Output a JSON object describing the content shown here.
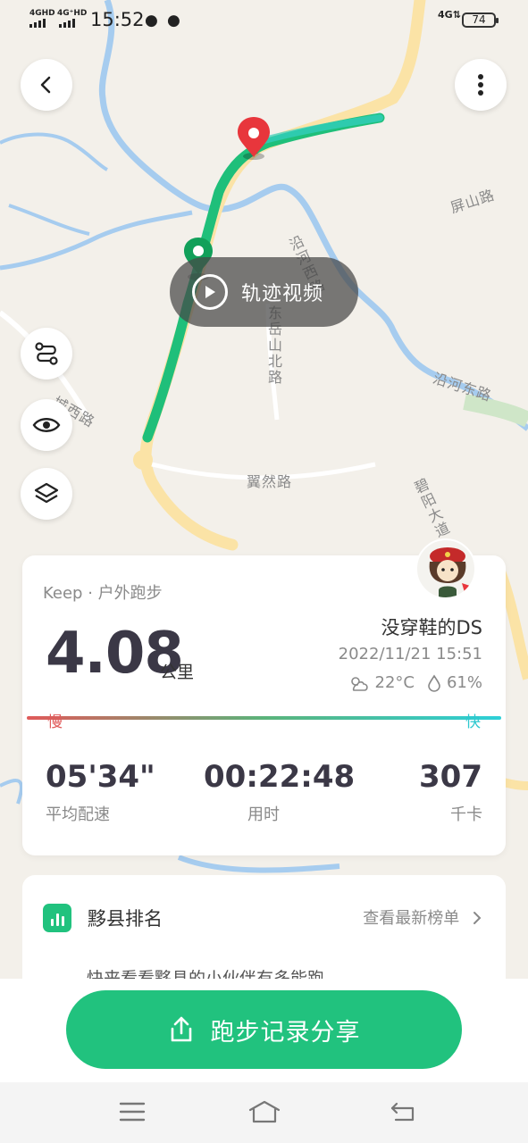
{
  "status_bar": {
    "net1": "4GHD",
    "net2": "4G⁺HD",
    "time": "15:52",
    "net3": "4G⇅",
    "battery": "74"
  },
  "map": {
    "labels": [
      "屏山路",
      "沿河西路",
      "东岳山北路",
      "沿河东路",
      "城西路",
      "翼然路",
      "碧阳大道"
    ]
  },
  "video_button": {
    "label": "轨迹视频"
  },
  "summary": {
    "source": "Keep · 户外跑步",
    "distance": "4.08",
    "distance_unit": "公里",
    "user": "没穿鞋的DS",
    "datetime": "2022/11/21 15:51",
    "temperature": "22°C",
    "humidity": "61%",
    "pace_slow": "慢",
    "pace_fast": "快",
    "stats": [
      {
        "value": "05'34\"",
        "label": "平均配速"
      },
      {
        "value": "00:22:48",
        "label": "用时"
      },
      {
        "value": "307",
        "label": "千卡"
      }
    ]
  },
  "ranking": {
    "title": "黟县排名",
    "link": "查看最新榜单",
    "subtitle": "快来看看黟县的小伙伴有多能跑"
  },
  "share": {
    "label": "跑步记录分享"
  },
  "colors": {
    "accent": "#21c27e",
    "route": "#1fbf7a",
    "pin": "#e8363c",
    "text_dark": "#3b3846"
  }
}
